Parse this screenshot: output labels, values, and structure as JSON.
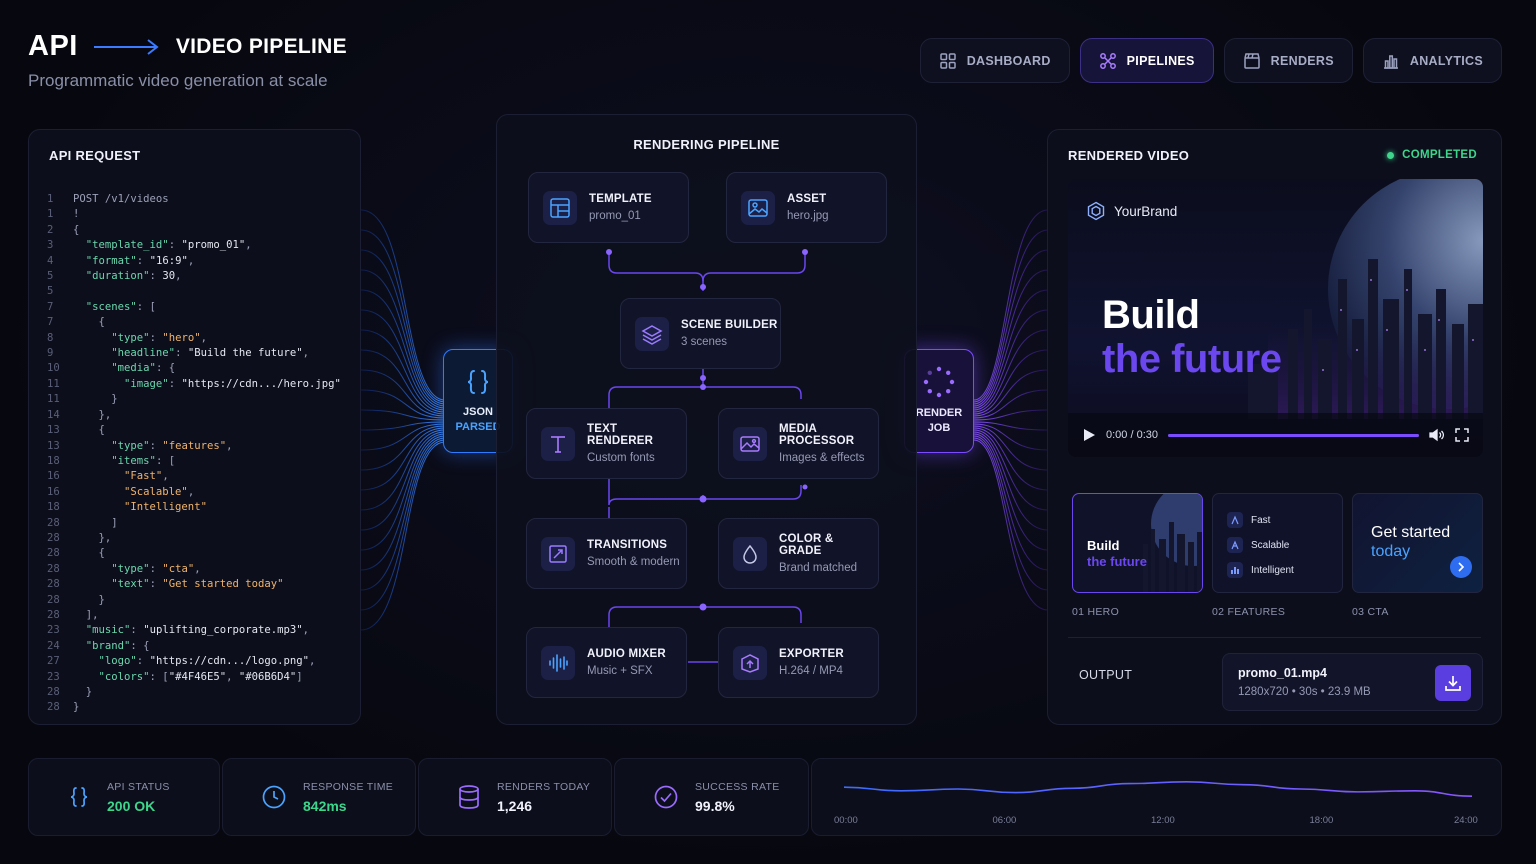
{
  "header": {
    "title_left": "API",
    "title_right": "VIDEO PIPELINE",
    "subtitle": "Programmatic video generation at scale"
  },
  "nav": [
    {
      "label": "DASHBOARD",
      "icon": "grid-icon",
      "active": false
    },
    {
      "label": "PIPELINES",
      "icon": "nodes-icon",
      "active": true
    },
    {
      "label": "RENDERS",
      "icon": "clapper-icon",
      "active": false
    },
    {
      "label": "ANALYTICS",
      "icon": "bar-chart-icon",
      "active": false
    }
  ],
  "api_panel": {
    "title": "API REQUEST",
    "code": [
      {
        "ln": "1",
        "html": "<span class='p'>POST /v1/videos</span>"
      },
      {
        "ln": "1",
        "html": "<span class='p'>!</span>"
      },
      {
        "ln": "2",
        "html": "<span class='p'>{</span>"
      },
      {
        "ln": "3",
        "html": "  <span class='k'>\"template_id\"</span><span class='p'>: </span><span class='n'>\"promo_01\"</span><span class='p'>,</span>"
      },
      {
        "ln": "4",
        "html": "  <span class='k'>\"format\"</span><span class='p'>: </span><span class='n'>\"16:9\"</span><span class='p'>,</span>"
      },
      {
        "ln": "5",
        "html": "  <span class='k'>\"duration\"</span><span class='p'>: </span><span class='n'>30</span><span class='p'>,</span>"
      },
      {
        "ln": "5",
        "html": ""
      },
      {
        "ln": "7",
        "html": "  <span class='k'>\"scenes\"</span><span class='p'>: [</span>"
      },
      {
        "ln": "7",
        "html": "    <span class='p'>{</span>"
      },
      {
        "ln": "8",
        "html": "      <span class='k'>\"type\"</span><span class='p'>: </span><span class='s'>\"hero\"</span><span class='p'>,</span>"
      },
      {
        "ln": "9",
        "html": "      <span class='k'>\"headline\"</span><span class='p'>: </span><span class='n'>\"Build the future\"</span><span class='p'>,</span>"
      },
      {
        "ln": "10",
        "html": "      <span class='k'>\"media\"</span><span class='p'>: {</span>"
      },
      {
        "ln": "11",
        "html": "        <span class='k'>\"image\"</span><span class='p'>: </span><span class='n'>\"https://cdn.../hero.jpg\"</span>"
      },
      {
        "ln": "11",
        "html": "      <span class='p'>}</span>"
      },
      {
        "ln": "14",
        "html": "    <span class='p'>},</span>"
      },
      {
        "ln": "13",
        "html": "    <span class='p'>{</span>"
      },
      {
        "ln": "13",
        "html": "      <span class='k'>\"type\"</span><span class='p'>: </span><span class='s'>\"features\"</span><span class='p'>,</span>"
      },
      {
        "ln": "18",
        "html": "      <span class='k'>\"items\"</span><span class='p'>: [</span>"
      },
      {
        "ln": "16",
        "html": "        <span class='s'>\"Fast\"</span><span class='p'>,</span>"
      },
      {
        "ln": "16",
        "html": "        <span class='s'>\"Scalable\"</span><span class='p'>,</span>"
      },
      {
        "ln": "18",
        "html": "        <span class='s'>\"Intelligent\"</span>"
      },
      {
        "ln": "28",
        "html": "      <span class='p'>]</span>"
      },
      {
        "ln": "28",
        "html": "    <span class='p'>},</span>"
      },
      {
        "ln": "28",
        "html": "    <span class='p'>{</span>"
      },
      {
        "ln": "28",
        "html": "      <span class='k'>\"type\"</span><span class='p'>: </span><span class='s'>\"cta\"</span><span class='p'>,</span>"
      },
      {
        "ln": "28",
        "html": "      <span class='k'>\"text\"</span><span class='p'>: </span><span class='s'>\"Get started today\"</span>"
      },
      {
        "ln": "28",
        "html": "    <span class='p'>}</span>"
      },
      {
        "ln": "28",
        "html": "  <span class='p'>],</span>"
      },
      {
        "ln": "23",
        "html": "  <span class='k'>\"music\"</span><span class='p'>: </span><span class='n'>\"uplifting_corporate.mp3\"</span><span class='p'>,</span>"
      },
      {
        "ln": "24",
        "html": "  <span class='k'>\"brand\"</span><span class='p'>: {</span>"
      },
      {
        "ln": "27",
        "html": "    <span class='k'>\"logo\"</span><span class='p'>: </span><span class='n'>\"https://cdn.../logo.png\"</span><span class='p'>,</span>"
      },
      {
        "ln": "23",
        "html": "    <span class='k'>\"colors\"</span><span class='p'>: [</span><span class='n'>\"#4F46E5\"</span><span class='p'>, </span><span class='n'>\"#06B6D4\"</span><span class='p'>]</span>"
      },
      {
        "ln": "28",
        "html": "  <span class='p'>}</span>"
      },
      {
        "ln": "28",
        "html": "<span class='p'>}</span>"
      }
    ]
  },
  "hubs": {
    "json": {
      "line1": "JSON",
      "line2": "PARSED"
    },
    "render": {
      "line1": "RENDER",
      "line2": "JOB"
    }
  },
  "pipeline": {
    "title": "RENDERING PIPELINE",
    "nodes": {
      "template": {
        "title": "TEMPLATE",
        "sub": "promo_01"
      },
      "asset": {
        "title": "ASSET",
        "sub": "hero.jpg"
      },
      "scene": {
        "title": "SCENE BUILDER",
        "sub": "3 scenes"
      },
      "text": {
        "title": "TEXT RENDERER",
        "sub": "Custom fonts"
      },
      "media": {
        "title": "MEDIA PROCESSOR",
        "sub": "Images & effects"
      },
      "transitions": {
        "title": "TRANSITIONS",
        "sub": "Smooth & modern"
      },
      "color": {
        "title": "COLOR & GRADE",
        "sub": "Brand matched"
      },
      "audio": {
        "title": "AUDIO MIXER",
        "sub": "Music + SFX"
      },
      "exporter": {
        "title": "EXPORTER",
        "sub": "H.264 / MP4"
      }
    }
  },
  "video_panel": {
    "title": "RENDERED VIDEO",
    "status": "COMPLETED",
    "brand": "YourBrand",
    "headline1": "Build",
    "headline2": "the future",
    "time": "0:00 / 0:30",
    "progress": 1.0,
    "scenes": [
      {
        "label": "01  HERO",
        "line1": "Build",
        "line2": "the future"
      },
      {
        "label": "02  FEATURES",
        "items": [
          "Fast",
          "Scalable",
          "Intelligent"
        ]
      },
      {
        "label": "03  CTA",
        "line1": "Get started",
        "line2": "today"
      }
    ],
    "output_label": "OUTPUT",
    "file_name": "promo_01.mp4",
    "file_meta": "1280x720  •  30s  •  23.9 MB"
  },
  "stats": [
    {
      "label": "API STATUS",
      "value": "200 OK",
      "color": "#3dd68c",
      "icon": "braces-icon"
    },
    {
      "label": "RESPONSE TIME",
      "value": "842ms",
      "color": "#3dd68c",
      "icon": "clock-icon"
    },
    {
      "label": "RENDERS TODAY",
      "value": "1,246",
      "color": "#f1f2fb",
      "icon": "database-icon"
    },
    {
      "label": "SUCCESS RATE",
      "value": "99.8%",
      "color": "#f1f2fb",
      "icon": "check-circle-icon"
    }
  ],
  "chart_data": {
    "type": "line",
    "x": [
      "00:00",
      "06:00",
      "12:00",
      "18:00",
      "24:00"
    ],
    "series": [
      {
        "values": [
          0.55,
          0.45,
          0.5,
          0.4,
          0.52,
          0.65,
          0.7,
          0.62,
          0.5,
          0.42,
          0.45,
          0.3
        ]
      }
    ],
    "grid": false
  }
}
